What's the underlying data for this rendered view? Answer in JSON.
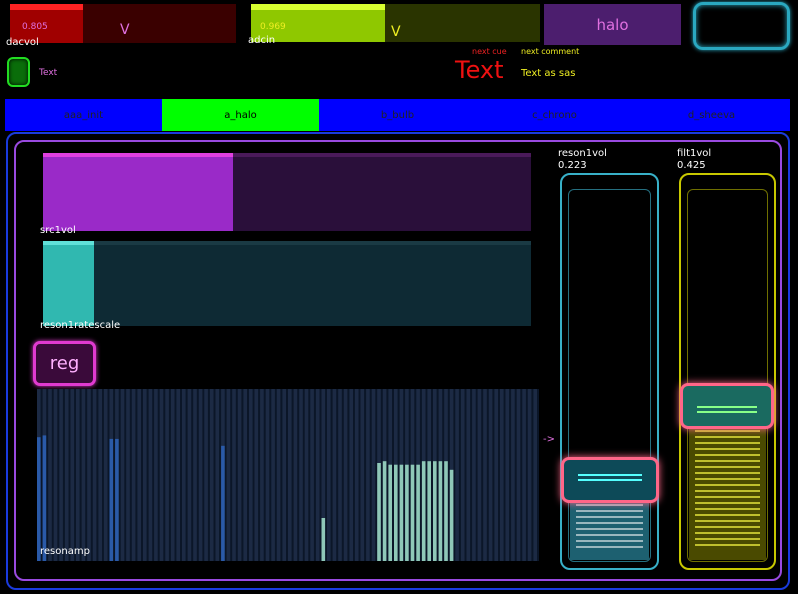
{
  "top": {
    "dacvol": {
      "label": "dacvol",
      "value_text": "0.805",
      "value": 0.805,
      "v_label": "V",
      "fill_color": "#a00000",
      "track_color": "#3a0000"
    },
    "adcin": {
      "label": "adcin",
      "value_text": "0.969",
      "value": 0.969,
      "v_label": "V",
      "fill_color": "#8fc800",
      "track_color": "#2a3400"
    },
    "halo_button": "halo",
    "green_toggle_text": "Text",
    "next_cue_label": "next cue",
    "next_comment_label": "next comment",
    "cue_text": "Text",
    "comment_text": "Text as sas"
  },
  "tabs": [
    {
      "label": "aaa_init",
      "active": false
    },
    {
      "label": "a_halo",
      "active": true
    },
    {
      "label": "b_bulb",
      "active": false
    },
    {
      "label": "c_chrono",
      "active": false
    },
    {
      "label": "d_sheeva",
      "active": false
    }
  ],
  "panel": {
    "src1vol": {
      "label": "src1vol",
      "value": 0.39,
      "fill_color": "#9a2ac8",
      "cap_color": "#e040e0",
      "track_color": "#2a0f3a"
    },
    "reson1ratescale": {
      "label": "reson1ratescale",
      "value": 0.105,
      "fill_color": "#30b8b0",
      "cap_color": "#60e0d8",
      "track_color": "#0e2a34"
    },
    "reg_button": "reg",
    "resonamp": {
      "label": "resonamp",
      "values": [
        0.72,
        0.73,
        0,
        0,
        0,
        0,
        0,
        0,
        0,
        0,
        0,
        0,
        0,
        0.71,
        0.71,
        0,
        0,
        0,
        0,
        0,
        0,
        0,
        0,
        0,
        0,
        0,
        0,
        0,
        0,
        0,
        0,
        0,
        0,
        0.67,
        0,
        0,
        0,
        0,
        0,
        0,
        0,
        0,
        0,
        0,
        0,
        0,
        0,
        0,
        0,
        0,
        0,
        0.25,
        0,
        0,
        0,
        0,
        0,
        0,
        0,
        0,
        0,
        0.57,
        0.58,
        0.56,
        0.56,
        0.56,
        0.56,
        0.56,
        0.56,
        0.58,
        0.58,
        0.58,
        0.58,
        0.58,
        0.53,
        0,
        0,
        0,
        0,
        0,
        0,
        0,
        0,
        0,
        0,
        0,
        0,
        0,
        0,
        0
      ],
      "colors": {
        "low": "#2a5aa8",
        "high": "#8fc8b8",
        "bg_bar": "#1c2a44"
      }
    },
    "reson1vol": {
      "label": "reson1vol",
      "value_text": "0.223",
      "value": 0.223,
      "color": "#38b0c8",
      "fill_color": "#2a8aa8"
    },
    "filt1vol": {
      "label": "filt1vol",
      "value_text": "0.425",
      "value": 0.425,
      "color": "#c8c800",
      "fill_color": "#7a7a00"
    },
    "arrow": "->"
  }
}
